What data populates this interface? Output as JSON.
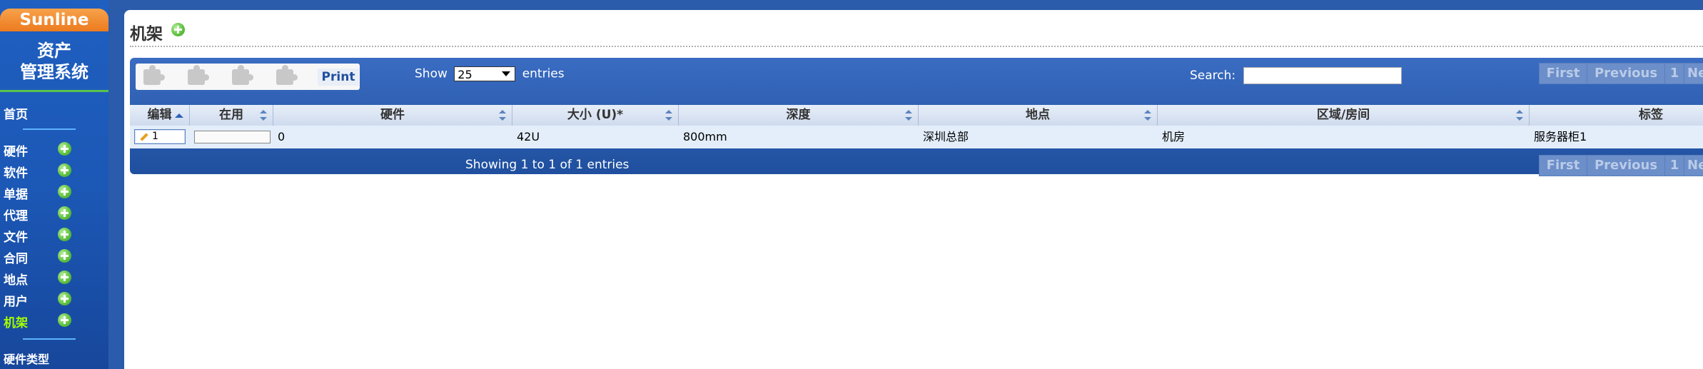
{
  "sidebar": {
    "logo": "Sunline",
    "app_title_line1": "资产",
    "app_title_line2": "管理系统",
    "home": "首页",
    "items": [
      {
        "label": "硬件"
      },
      {
        "label": "软件"
      },
      {
        "label": "单据"
      },
      {
        "label": "代理"
      },
      {
        "label": "文件"
      },
      {
        "label": "合同"
      },
      {
        "label": "地点"
      },
      {
        "label": "用户"
      },
      {
        "label": "机架",
        "active": true
      }
    ],
    "hardware_types": "硬件类型",
    "active_color": "#a6ff00"
  },
  "page": {
    "title": "机架"
  },
  "toolbar": {
    "print_label": "Print"
  },
  "length": {
    "show_label": "Show",
    "selected": "25",
    "entries_label": "entries"
  },
  "search": {
    "label": "Search:",
    "value": ""
  },
  "pagination": {
    "first": "First",
    "previous": "Previous",
    "page": "1",
    "next_partial": "Ne"
  },
  "table": {
    "headers": [
      "编辑",
      "在用",
      "硬件",
      "大小 (U)*",
      "深度",
      "地点",
      "区域/房间",
      "标签"
    ],
    "rows": [
      {
        "edit": "1",
        "inuse": "",
        "hardware": "0",
        "size": "42U",
        "depth": "800mm",
        "location": "深圳总部",
        "room": "机房",
        "tag": "服务器柜1"
      }
    ]
  },
  "info": "Showing 1 to 1 of 1 entries",
  "colors": {
    "header_bg": "#2b5bab",
    "logo_orange": "#ec7b1f",
    "plus_green": "#62c342"
  }
}
